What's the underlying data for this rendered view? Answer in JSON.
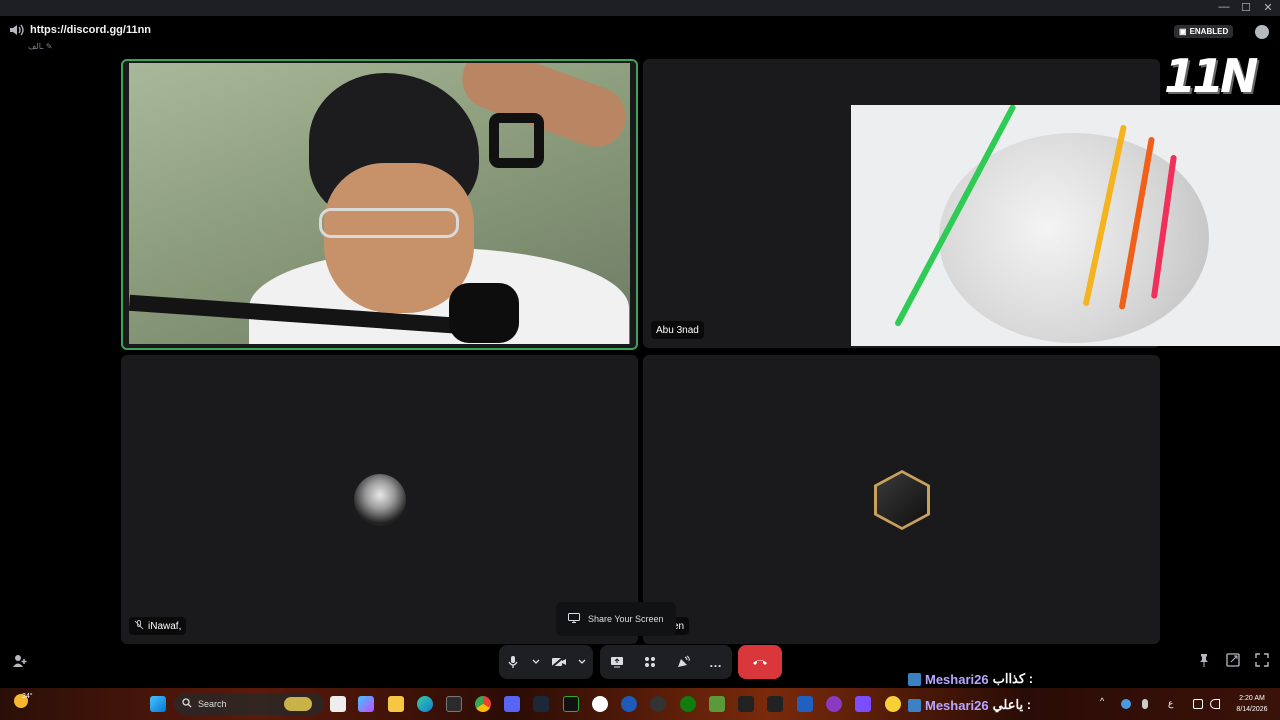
{
  "window": {
    "controls": [
      "—",
      "☐",
      "✕"
    ]
  },
  "channel": {
    "url": "https://discord.gg/11nn",
    "subtitle": "ـالف ✎"
  },
  "badge": {
    "label": "ENABLED"
  },
  "logo": {
    "text": "11N"
  },
  "tiles": [
    {
      "name": "",
      "has_video": true
    },
    {
      "name": "Abu 3nad",
      "has_video": false
    },
    {
      "name": "iNawaf,",
      "has_video": false
    },
    {
      "name": "ven",
      "has_video": false
    }
  ],
  "tooltip": {
    "label": "Share Your Screen"
  },
  "controls": {
    "mic": "microphone",
    "camera": "camera-off",
    "share": "screen-share",
    "activities": "activities",
    "soundboard": "soundboard",
    "more": "…",
    "end": "end-call"
  },
  "chat_overlay": [
    {
      "user": "Meshari26",
      "message": "كذااب :"
    },
    {
      "user": "Meshari26",
      "message": "ياعلي :"
    }
  ],
  "taskbar": {
    "weather": "34°",
    "search_placeholder": "Search",
    "time": "2:20 AM",
    "date": "8/14/2026",
    "lang": "ع"
  },
  "colors": {
    "speaking": "#3ba55c",
    "end_call": "#da373c",
    "username": "#b9a6ff"
  }
}
